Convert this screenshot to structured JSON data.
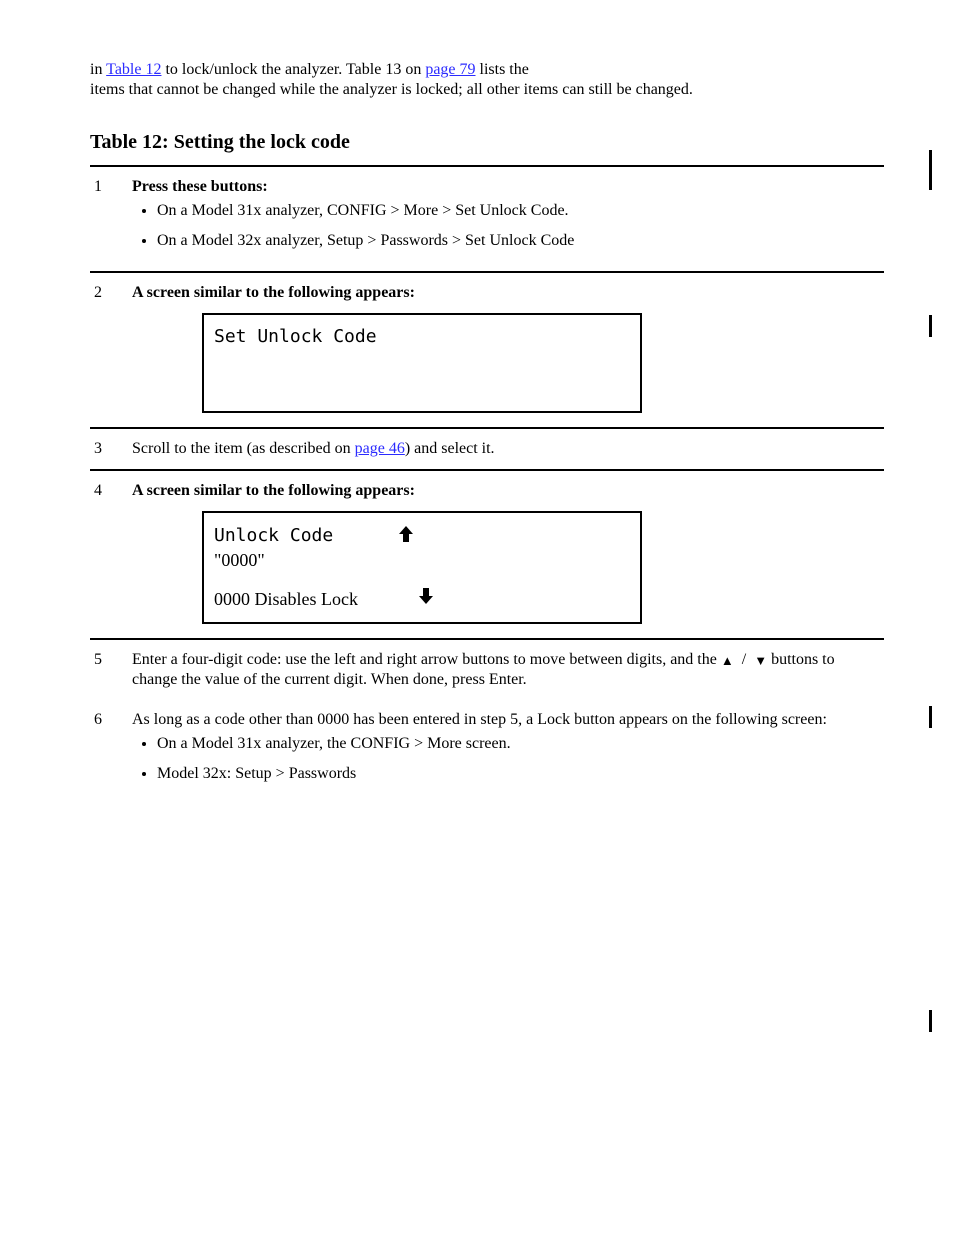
{
  "intro": {
    "line1_prefix": "in ",
    "line1_link": "Table 12",
    "line1_mid": " to lock/unlock the analyzer. Table 13 on ",
    "line1_link2": "page 79",
    "line1_suffix": " lists the",
    "line2": "items that cannot be changed while the analyzer is locked; all other items can still be changed."
  },
  "heading_table12": "Table 12: Setting the lock code",
  "steps": {
    "s1": {
      "num": "1",
      "label": "Press these buttons:",
      "items": [
        "On a Model 31x analyzer, CONFIG > More > Set Unlock Code.",
        "On a Model 32x analyzer, Setup > Passwords > Set Unlock Code"
      ]
    },
    "s2": {
      "num": "2",
      "label": "A screen similar to the following appears:"
    },
    "screen1": {
      "title": "Set Unlock Code"
    },
    "s3": {
      "num": "3",
      "text_before_link": "Scroll to the item (as described on ",
      "link": "page 46",
      "text_after_link": ") and select it."
    },
    "s4": {
      "num": "4",
      "label": "A screen similar to the following appears:"
    },
    "screen2": {
      "line1": "Unlock Code",
      "line2": "\"0000\"",
      "line3": "0000 Disables Lock"
    },
    "s5": {
      "num": "5",
      "text_before": "Enter a four-digit code: use the left and right arrow buttons to move between digits, and the",
      "text_after": " buttons to change the value of the current digit. When done, press Enter."
    },
    "s6": {
      "num": "6",
      "text": "As long as a code other than 0000 has been entered in step 5, a Lock button appears on the following screen:",
      "items": [
        "On a Model 31x analyzer, the CONFIG > More screen.",
        "Model 32x: Setup > Passwords"
      ]
    }
  },
  "arrows": {
    "up": "▲",
    "down": "▼",
    "up_bold": "↑",
    "down_bold": "↓"
  }
}
